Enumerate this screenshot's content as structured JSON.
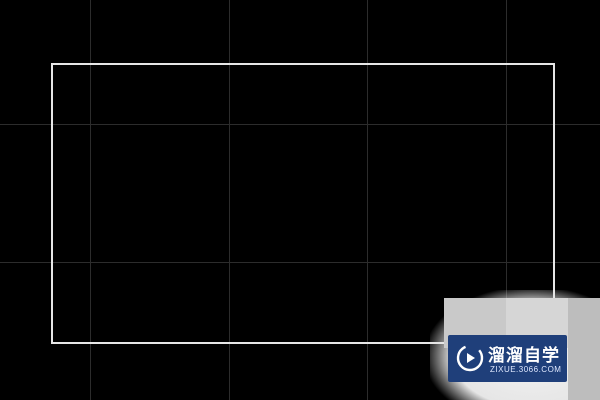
{
  "canvas": {
    "background": "#000000",
    "grid_color": "#232323",
    "shape": {
      "type": "rectangle",
      "stroke_color": "#e6e6e6",
      "fill": "none"
    }
  },
  "watermark": {
    "title": "溜溜自学",
    "url": "ZIXUE.3066.COM",
    "badge_color": "#1f3f7a",
    "icon": "play-logo-icon"
  }
}
